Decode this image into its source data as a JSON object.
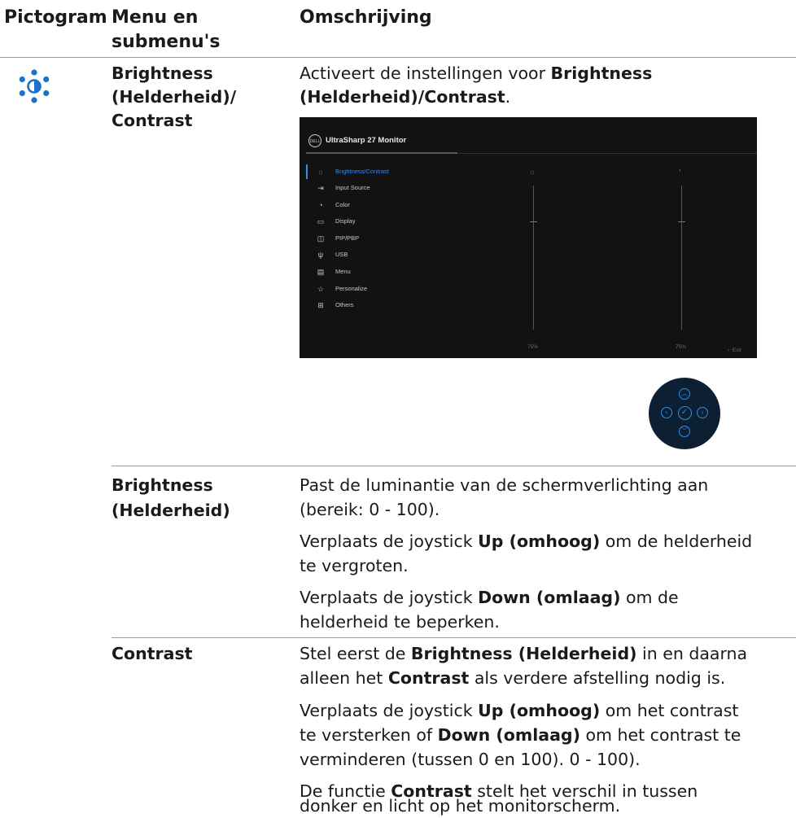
{
  "header": {
    "col1": "Pictogram",
    "col2_line1": "Menu en",
    "col2_line2": "submenu's",
    "col3": "Omschrijving"
  },
  "section_main": {
    "icon": "brightness-icon",
    "menu_line1": "Brightness",
    "menu_line2": "(Helderheid)/",
    "menu_line3": "Contrast",
    "desc_prefix": "Activeert de instellingen voor ",
    "desc_bold1": "Brightness",
    "desc_bold2": "(Helderheid)/Contrast",
    "desc_suffix": "."
  },
  "osd": {
    "title": "UltraSharp 27 Monitor",
    "logo": "DELL",
    "menu_items": [
      {
        "label": "Brightness/Contrast",
        "icon": "sun-icon",
        "active": true
      },
      {
        "label": "Input Source",
        "icon": "input-icon"
      },
      {
        "label": "Color",
        "icon": "color-icon"
      },
      {
        "label": "Display",
        "icon": "display-icon"
      },
      {
        "label": "PIP/PBP",
        "icon": "pip-icon"
      },
      {
        "label": "USB",
        "icon": "usb-icon"
      },
      {
        "label": "Menu",
        "icon": "menu-icon"
      },
      {
        "label": "Personalize",
        "icon": "star-icon"
      },
      {
        "label": "Others",
        "icon": "others-icon"
      }
    ],
    "brightness_value": "75%",
    "contrast_value": "75%",
    "exit_label": "Exit"
  },
  "section_brightness": {
    "label_line1": "Brightness",
    "label_line2": "(Helderheid)",
    "p1_line1": "Past de luminantie van de schermverlichting aan",
    "p1_line2": "(bereik: 0 - 100).",
    "p2_prefix": "Verplaats de joystick ",
    "p2_bold": "Up (omhoog)",
    "p2_suffix": " om de helderheid",
    "p2_line2": "te vergroten.",
    "p3_prefix": "Verplaats de joystick ",
    "p3_bold": "Down (omlaag)",
    "p3_suffix": " om de",
    "p3_line2": "helderheid te beperken."
  },
  "section_contrast": {
    "label": "Contrast",
    "p1_prefix": "Stel eerst de ",
    "p1_bold1": "Brightness (Helderheid)",
    "p1_mid": " in en daarna",
    "p1_l2_prefix": "alleen het ",
    "p1_bold2": "Contrast",
    "p1_l2_suffix": " als verdere afstelling nodig is.",
    "p2_prefix": "Verplaats de joystick ",
    "p2_bold1": "Up (omhoog)",
    "p2_suffix": " om het contrast",
    "p2_l2_prefix": "te versterken of ",
    "p2_bold2": "Down (omlaag)",
    "p2_l2_suffix": " om het contrast te",
    "p2_line3": "verminderen (tussen 0 en 100). 0 - 100).",
    "p3_prefix": "De functie ",
    "p3_bold": "Contrast",
    "p3_suffix": " stelt het verschil in tussen",
    "p3_line2": "donker en licht op het monitorscherm."
  }
}
